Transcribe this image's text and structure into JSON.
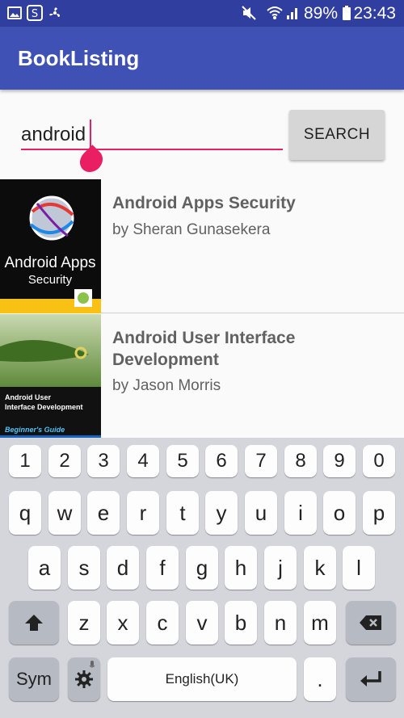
{
  "status_bar": {
    "battery": "89%",
    "time": "23:43",
    "icons": [
      "gallery-icon",
      "shazam-icon",
      "fan-icon",
      "mute-icon",
      "wifi-icon",
      "signal-icon",
      "battery-icon"
    ]
  },
  "app_bar": {
    "title": "BookListing"
  },
  "search": {
    "value": "android",
    "button_label": "SEARCH"
  },
  "books": [
    {
      "title": "Android Apps Security",
      "author": "by Sheran Gunasekera",
      "cover": {
        "line1": "Android Apps",
        "line2": "Security"
      }
    },
    {
      "title": "Android User Interface Development",
      "author": "by Jason Morris",
      "cover": {
        "line1": "Android User",
        "line2": "Interface Development",
        "badge": "Beginner's Guide"
      }
    }
  ],
  "keyboard": {
    "number_row": [
      "1",
      "2",
      "3",
      "4",
      "5",
      "6",
      "7",
      "8",
      "9",
      "0"
    ],
    "row1": [
      "q",
      "w",
      "e",
      "r",
      "t",
      "y",
      "u",
      "i",
      "o",
      "p"
    ],
    "row2": [
      "a",
      "s",
      "d",
      "f",
      "g",
      "h",
      "j",
      "k",
      "l"
    ],
    "row3": [
      "z",
      "x",
      "c",
      "v",
      "b",
      "n",
      "m"
    ],
    "sym_label": "Sym",
    "space_label": "English(UK)",
    "period_label": "."
  },
  "colors": {
    "primary_dark": "#303f9f",
    "primary": "#3f51b5",
    "accent": "#e91e63"
  }
}
